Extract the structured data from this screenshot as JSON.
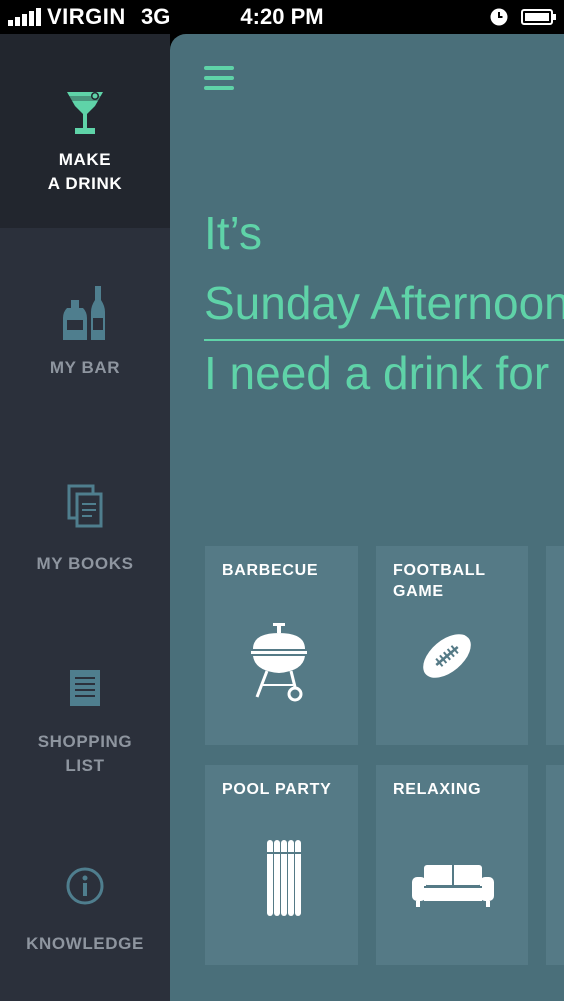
{
  "status_bar": {
    "carrier": "VIRGIN",
    "network": "3G",
    "time": "4:20 PM"
  },
  "sidebar": {
    "items": [
      {
        "label": "MAKE\nA DRINK",
        "icon": "cocktail-glass-icon",
        "active": true
      },
      {
        "label": "MY BAR",
        "icon": "bottles-icon",
        "active": false
      },
      {
        "label": "MY BOOKS",
        "icon": "books-icon",
        "active": false
      },
      {
        "label": "SHOPPING\nLIST",
        "icon": "list-icon",
        "active": false
      },
      {
        "label": "KNOWLEDGE",
        "icon": "info-icon",
        "active": false
      }
    ]
  },
  "main": {
    "menu_icon": "hamburger-icon",
    "headline_lines": [
      "It’s",
      "Sunday Afternoon",
      "I need a drink for"
    ],
    "tiles": [
      {
        "label": "BARBECUE",
        "icon": "grill-icon"
      },
      {
        "label": "FOOTBALL\nGAME",
        "icon": "football-icon"
      },
      {
        "label": "POOL PARTY",
        "icon": "pool-float-icon"
      },
      {
        "label": "RELAXING",
        "icon": "sofa-icon"
      }
    ]
  },
  "colors": {
    "accent": "#5fd3a8",
    "sidebar_bg": "#2b303b",
    "sidebar_active_bg": "#22262e",
    "main_bg": "#4a6f7a",
    "tile_bg": "#557a86"
  }
}
